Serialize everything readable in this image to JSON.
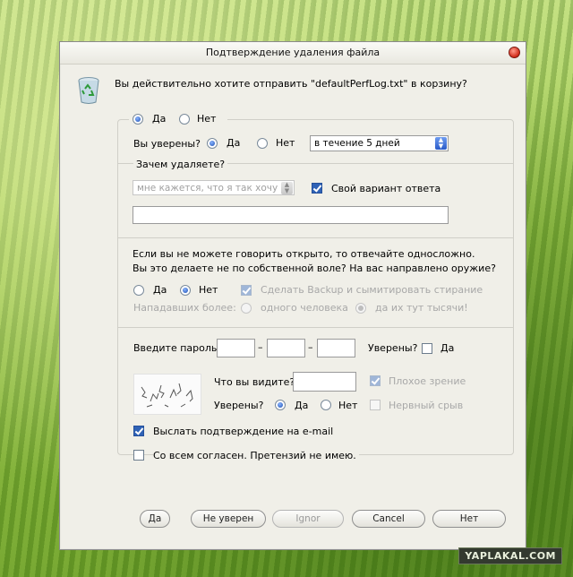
{
  "window": {
    "title": "Подтверждение удаления файла"
  },
  "question": "Вы действительно хотите отправить \"defaultPerfLog.txt\" в корзину?",
  "top_choice": {
    "yes": "Да",
    "no": "Нет"
  },
  "sure_row": {
    "label": "Вы уверены?",
    "yes": "Да",
    "no": "Нет",
    "period_value": "в течение 5 дней"
  },
  "why": {
    "label": "Зачем удаляете?",
    "reason_value": "мне кажется, что я так хочу",
    "own_answer_label": "Свой вариант ответа",
    "own_answer_value": ""
  },
  "forced": {
    "line1": "Если вы не можете говорить открыто, то отвечайте односложно.",
    "line2": "Вы это делаете не по собственной воле? На вас направлено оружие?",
    "yes": "Да",
    "no": "Нет",
    "backup_label": "Сделать Backup и сымитировать стирание",
    "attackers_label": "Нападавших более:",
    "one_person": "одного человека",
    "thousands": "да их тут тысячи!"
  },
  "password": {
    "label": "Введите пароль:",
    "dash": "–",
    "part1": "",
    "part2": "",
    "part3": "",
    "sure_label": "Уверены?",
    "sure_yes": "Да"
  },
  "captcha": {
    "what_label": "Что вы видите?",
    "answer": "",
    "bad_sight": "Плохое зрение",
    "sure_label": "Уверены?",
    "yes": "Да",
    "no": "Нет",
    "nervous": "Нервный срыв"
  },
  "email_confirm": "Выслать подтверждение на e-mail",
  "agree": "Со всем согласен. Претензий не имею.",
  "buttons": {
    "yes": "Да",
    "not_sure": "Не уверен",
    "ignore": "Ignor",
    "cancel": "Cancel",
    "no": "Нет"
  },
  "watermark": "YAPLAKAL.COM",
  "colors": {
    "accent": "#2f62b6",
    "window_bg": "#f0efe8",
    "disabled_text": "#a8a8a8"
  }
}
